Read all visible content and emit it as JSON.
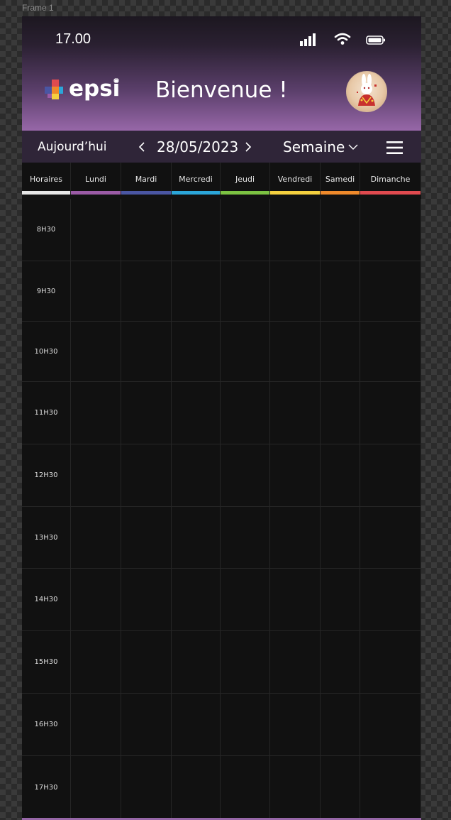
{
  "frame": {
    "label": "Frame 1"
  },
  "status_bar": {
    "time": "17.00",
    "icons": [
      "signal-icon",
      "wifi-icon",
      "battery-icon"
    ]
  },
  "header": {
    "logo_text": "epsi",
    "logo_mark": "®",
    "welcome": "Bienvenue !",
    "avatar": "avatar"
  },
  "navbar": {
    "today_label": "Aujourd’hui",
    "date": "28/05/2023",
    "view_label": "Semaine"
  },
  "days": [
    {
      "label": "Horaires",
      "color": "#e6e6e6"
    },
    {
      "label": "Lundi",
      "color": "#9b5ba6"
    },
    {
      "label": "Mardi",
      "color": "#4a56a3"
    },
    {
      "label": "Mercredi",
      "color": "#2ba6d9"
    },
    {
      "label": "Jeudi",
      "color": "#7cc242"
    },
    {
      "label": "Vendredi",
      "color": "#f4d03f"
    },
    {
      "label": "Samedi",
      "color": "#ef8a2b"
    },
    {
      "label": "Dimanche",
      "color": "#e04a4f"
    }
  ],
  "time_slots": [
    "8H30",
    "9H30",
    "10H30",
    "11H30",
    "12H30",
    "13H30",
    "14H30",
    "15H30",
    "16H30",
    "17H30"
  ],
  "colors": {
    "header_gradient_top": "#1c1720",
    "header_gradient_bottom": "#9767a8",
    "navbar_bg": "#2f2538",
    "grid_bg": "#111111"
  }
}
